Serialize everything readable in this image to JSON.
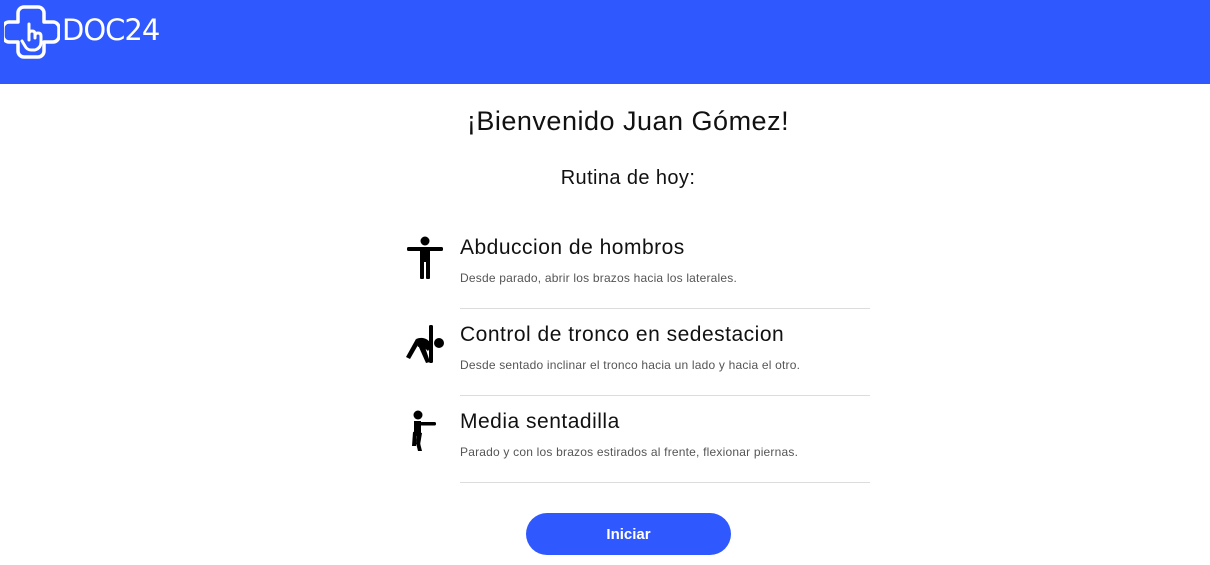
{
  "header": {
    "brand": "DOC24",
    "brand_color": "#2f58ff",
    "logo_icon": "cross-hand-icon"
  },
  "welcome": "¡Bienvenido Juan Gómez!",
  "routine_title": "Rutina de hoy:",
  "exercises": [
    {
      "icon": "arms-out-icon",
      "title": "Abduccion de hombros",
      "description": "Desde parado, abrir los brazos hacia los laterales."
    },
    {
      "icon": "side-bend-icon",
      "title": "Control de tronco en sedestacion",
      "description": "Desde sentado inclinar el tronco hacia un lado y hacia el otro."
    },
    {
      "icon": "squat-icon",
      "title": "Media sentadilla",
      "description": "Parado y con los brazos estirados al frente, flexionar piernas."
    }
  ],
  "start_button": "Iniciar"
}
